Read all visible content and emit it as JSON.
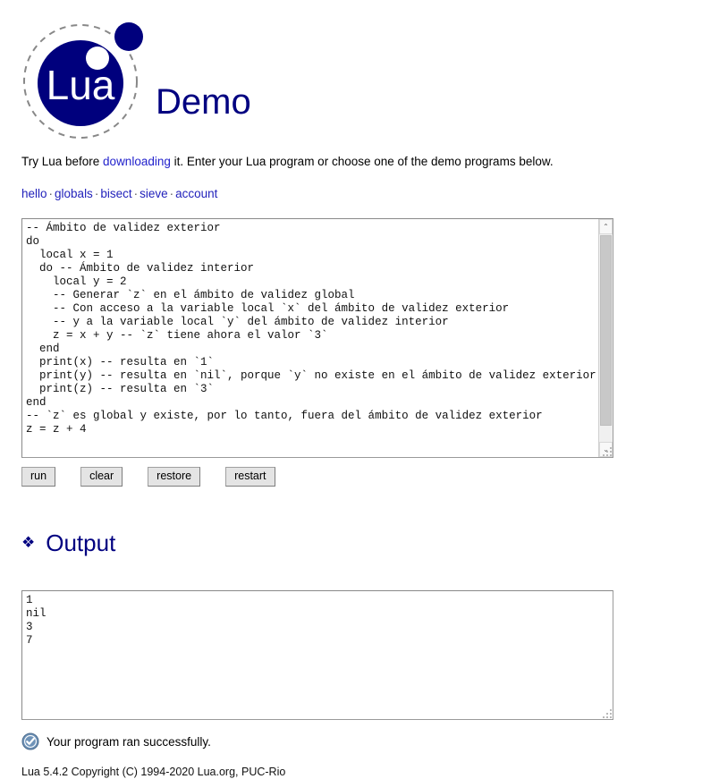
{
  "header": {
    "logo_alt": "Lua logo",
    "logo_text": "Lua",
    "title": "Demo"
  },
  "intro": {
    "before_link": "Try Lua before ",
    "link_text": "downloading",
    "after_link": " it. Enter your Lua program or choose one of the demo programs below."
  },
  "demo_links": {
    "separator": "·",
    "items": [
      {
        "label": "hello"
      },
      {
        "label": "globals"
      },
      {
        "label": "bisect"
      },
      {
        "label": "sieve"
      },
      {
        "label": "account"
      }
    ]
  },
  "editor": {
    "code": "-- Ámbito de validez exterior\ndo\n  local x = 1\n  do -- Ámbito de validez interior\n    local y = 2\n    -- Generar `z` en el ámbito de validez global\n    -- Con acceso a la variable local `x` del ámbito de validez exterior\n    -- y a la variable local `y` del ámbito de validez interior\n    z = x + y -- `z` tiene ahora el valor `3`\n  end\n  print(x) -- resulta en `1`\n  print(y) -- resulta en `nil`, porque `y` no existe en el ámbito de validez exterior\n  print(z) -- resulta en `3`\nend\n-- `z` es global y existe, por lo tanto, fuera del ámbito de validez exterior\nz = z + 4",
    "scrollbar": {
      "up_arrow": "⌃",
      "down_arrow": "⌄"
    }
  },
  "buttons": [
    {
      "label": "run",
      "name": "run-button"
    },
    {
      "label": "clear",
      "name": "clear-button"
    },
    {
      "label": "restore",
      "name": "restore-button"
    },
    {
      "label": "restart",
      "name": "restart-button"
    }
  ],
  "output_section": {
    "bullet_icon": "❖",
    "title": "Output",
    "text": "1\nnil\n3\n7"
  },
  "status": {
    "icon": "check-circle-icon",
    "check_glyph": "✔",
    "message": "Your program ran successfully."
  },
  "footer": {
    "text": "Lua 5.4.2 Copyright (C) 1994-2020 Lua.org, PUC-Rio"
  },
  "colors": {
    "navy": "#000080",
    "link": "#2222cc",
    "status_icon": "#5a7ca6"
  }
}
